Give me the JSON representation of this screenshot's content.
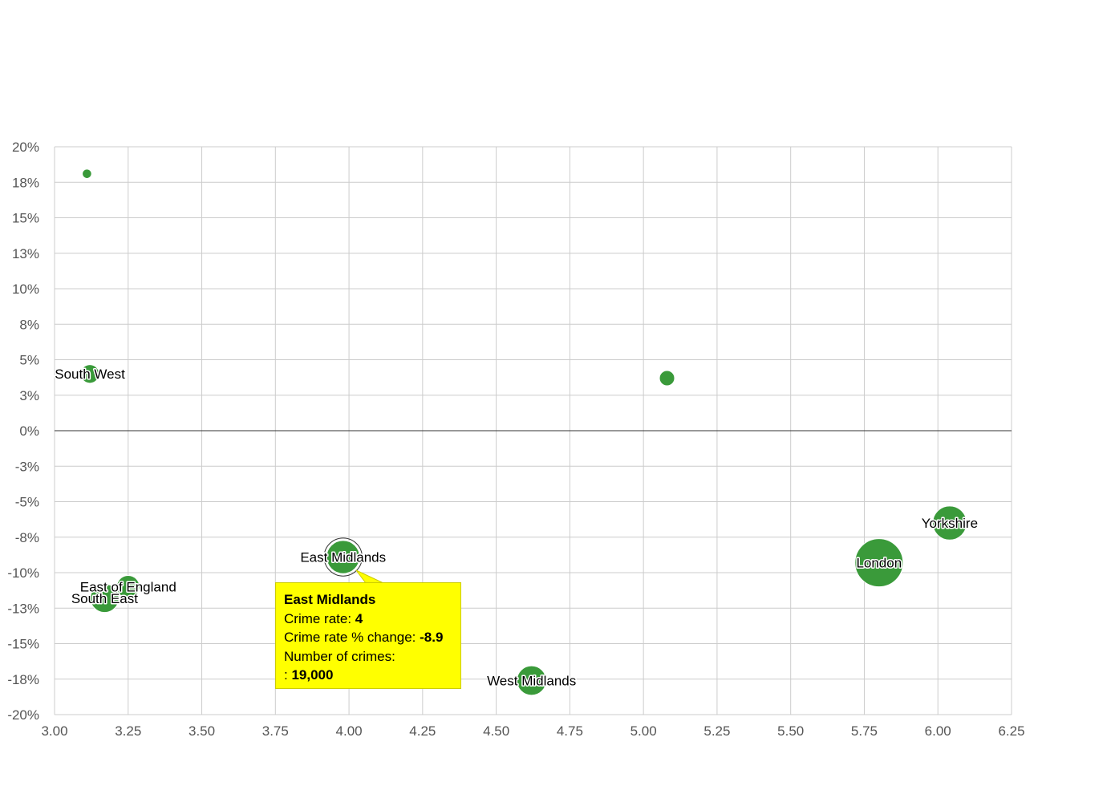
{
  "chart_data": {
    "type": "scatter",
    "subtype": "bubble",
    "xlim": [
      3.0,
      6.25
    ],
    "ylim": [
      -20,
      20
    ],
    "x_ticks": [
      "3.00",
      "3.25",
      "3.50",
      "3.75",
      "4.00",
      "4.25",
      "4.50",
      "4.75",
      "5.00",
      "5.25",
      "5.50",
      "5.75",
      "6.00",
      "6.25"
    ],
    "x_tick_values": [
      3.0,
      3.25,
      3.5,
      3.75,
      4.0,
      4.25,
      4.5,
      4.75,
      5.0,
      5.25,
      5.5,
      5.75,
      6.0,
      6.25
    ],
    "y_ticks": [
      "20%",
      "18%",
      "15%",
      "13%",
      "10%",
      "8%",
      "5%",
      "3%",
      "0%",
      "-3%",
      "-5%",
      "-8%",
      "-10%",
      "-13%",
      "-15%",
      "-18%",
      "-20%"
    ],
    "y_tick_values": [
      20,
      17.5,
      15,
      12.5,
      10,
      7.5,
      5,
      2.5,
      0,
      -2.5,
      -5,
      -7.5,
      -10,
      -12.5,
      -15,
      -17.5,
      -20
    ],
    "grid": true,
    "bubble_color": "#3a9a3a",
    "points": [
      {
        "label": "",
        "x": 3.11,
        "y": 18.1,
        "size": 1500
      },
      {
        "label": "South West",
        "x": 3.12,
        "y": 4.0,
        "size": 6000
      },
      {
        "label": "",
        "x": 5.08,
        "y": 3.7,
        "size": 4000
      },
      {
        "label": "East of England",
        "x": 3.25,
        "y": -11.0,
        "size": 9000
      },
      {
        "label": "South East",
        "x": 3.17,
        "y": -11.8,
        "size": 14000
      },
      {
        "label": "East Midlands",
        "x": 3.98,
        "y": -8.9,
        "size": 19000
      },
      {
        "label": "West Midlands",
        "x": 4.62,
        "y": -17.6,
        "size": 15000
      },
      {
        "label": "Yorkshire",
        "x": 6.04,
        "y": -6.5,
        "size": 20000
      },
      {
        "label": "London",
        "x": 5.8,
        "y": -9.3,
        "size": 40000
      }
    ]
  },
  "tooltip": {
    "title": "East Midlands",
    "rate_label": "Crime rate: ",
    "rate_value": "4",
    "change_label": "Crime rate % change: ",
    "change_value": "-8.9",
    "count_label": "Number of crimes:",
    "count_prefix": ": ",
    "count_value": "19,000"
  }
}
